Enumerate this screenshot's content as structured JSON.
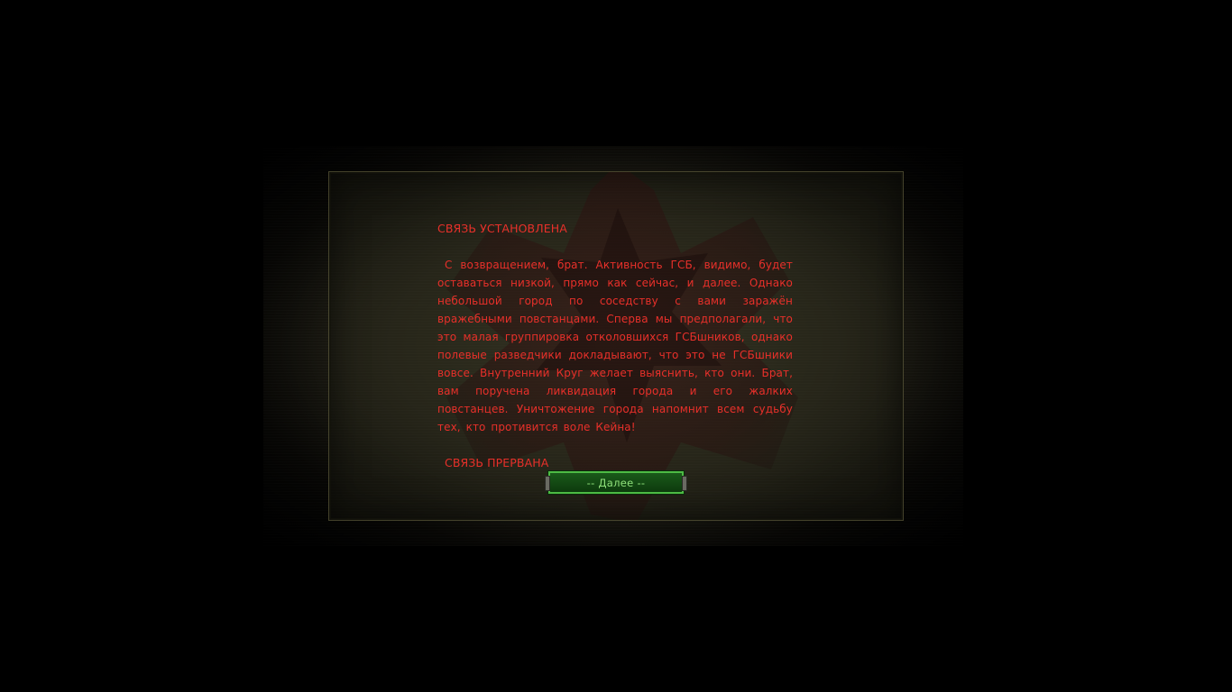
{
  "briefing": {
    "title": "СВЯЗЬ УСТАНОВЛЕНА",
    "message": "С возвращением, брат. Активность ГСБ, видимо, будет оставаться низкой, прямо как сейчас, и далее. Однако небольшой город по соседству с вами заражён вражебными повстанцами. Сперва мы предполагали, что это малая группировка отколовшихся ГСБшников, однако полевые разведчики докладывают, что это не ГСБшники вовсе. Внутренний Круг желает выяснить, кто они. Брат, вам поручена ликвидация города и его жалких повстанцев. Уничтожение города напомнит всем судьбу тех, кто противится воле Кейна!",
    "footer": "СВЯЗЬ ПРЕРВАНА",
    "continue_label": "-- Далее --"
  },
  "colors": {
    "text": "#e8302a",
    "button_border": "#4dbb44",
    "button_text": "#8fe07a",
    "panel": "#2c2a1c"
  },
  "icons": {
    "background_emblem": "faded-scorpion-emblem"
  }
}
